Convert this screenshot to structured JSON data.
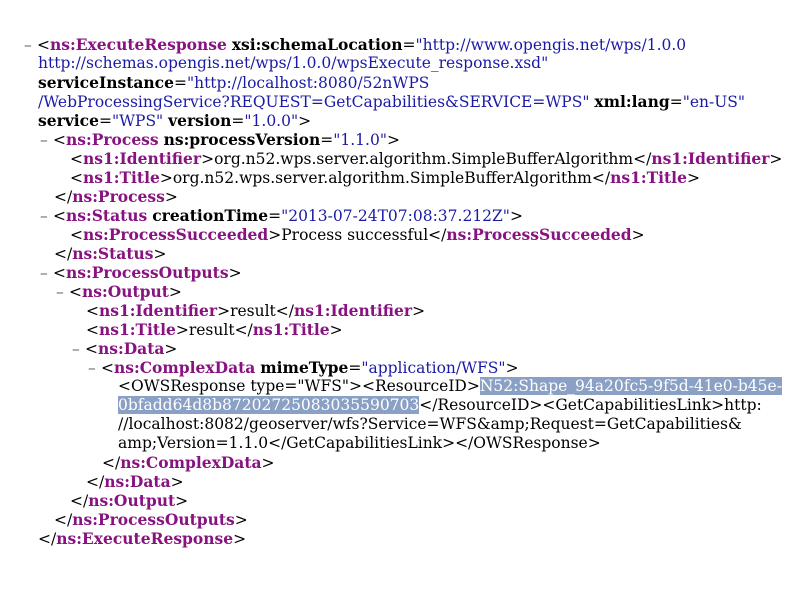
{
  "colors": {
    "tag_name": "#881280",
    "attr_value": "#1a1aa6",
    "selection_bg": "#8aa0c4",
    "toggle": "#666666"
  },
  "toggle_symbol": "–",
  "xml": {
    "root_tag": "ns:ExecuteResponse",
    "schema_location_attr": "xsi:schemaLocation",
    "schema_location_line1": "\"http://www.opengis.net/wps/1.0.0",
    "schema_location_line2": "http://schemas.opengis.net/wps/1.0.0/wpsExecute_response.xsd\"",
    "service_instance_attr": "serviceInstance",
    "service_instance_line1": "\"http://localhost:8080/52nWPS",
    "service_instance_line2": "/WebProcessingService?REQUEST=GetCapabilities&SERVICE=WPS\"",
    "lang_attr": "xml:lang",
    "lang_value": "\"en-US\"",
    "service_attr": "service",
    "service_value": "\"WPS\"",
    "version_attr": "version",
    "version_value": "\"1.0.0\"",
    "process": {
      "tag": "ns:Process",
      "attr": "ns:processVersion",
      "value": "\"1.1.0\"",
      "identifier_tag": "ns1:Identifier",
      "identifier_text": "org.n52.wps.server.algorithm.SimpleBufferAlgorithm",
      "title_tag": "ns1:Title",
      "title_text": "org.n52.wps.server.algorithm.SimpleBufferAlgorithm"
    },
    "status": {
      "tag": "ns:Status",
      "attr": "creationTime",
      "value": "\"2013-07-24T07:08:37.212Z\"",
      "succeeded_tag": "ns:ProcessSucceeded",
      "succeeded_text": "Process successful"
    },
    "outputs": {
      "tag": "ns:ProcessOutputs",
      "output_tag": "ns:Output",
      "identifier_tag": "ns1:Identifier",
      "identifier_text": "result",
      "title_tag": "ns1:Title",
      "title_text": "result",
      "data_tag": "ns:Data",
      "complex_tag": "ns:ComplexData",
      "mime_attr": "mimeType",
      "mime_value": "\"application/WFS\"",
      "content_line1_prefix": "<OWSResponse type=\"WFS\"><ResourceID>",
      "content_line1_selected": "N52:Shape_94a20fc5-9f5d-41e0-b45e-",
      "content_line2_selected": "0bfadd64d8b87202725083035590703",
      "content_line2_suffix": "</ResourceID><GetCapabilitiesLink>http:",
      "content_line3": "//localhost:8082/geoserver/wfs?Service=WFS&amp;Request=GetCapabilities&",
      "content_line4": "amp;Version=1.1.0</GetCapabilitiesLink></OWSResponse>"
    }
  }
}
